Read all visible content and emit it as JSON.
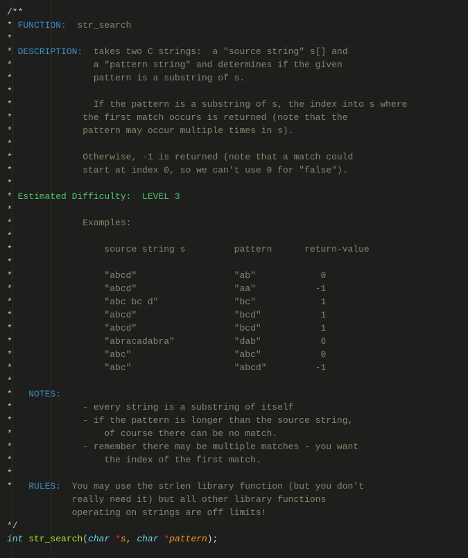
{
  "colors": {
    "background": "#1e1f1c",
    "comment_text": "#88846f",
    "star": "#cccccc",
    "header": "#3d8cc3",
    "difficulty": "#4fc36f",
    "keyword": "#66d9ef",
    "function": "#a6e22e",
    "operator": "#f92672",
    "identifier": "#fd971f",
    "punctuation": "#cccccc"
  },
  "lines": [
    [
      [
        "c-star",
        "/**"
      ]
    ],
    [
      [
        "c-star",
        "* "
      ],
      [
        "c-head",
        "FUNCTION:"
      ],
      [
        "c-comm",
        "  str_search"
      ]
    ],
    [
      [
        "c-star",
        "*"
      ]
    ],
    [
      [
        "c-star",
        "* "
      ],
      [
        "c-head",
        "DESCRIPTION:"
      ],
      [
        "c-comm",
        "  takes two C strings:  a \"source string\" s[] and"
      ]
    ],
    [
      [
        "c-star",
        "*"
      ],
      [
        "c-comm",
        "               a \"pattern string\" and determines if the given"
      ]
    ],
    [
      [
        "c-star",
        "*"
      ],
      [
        "c-comm",
        "               pattern is a substring of s."
      ]
    ],
    [
      [
        "c-star",
        "*"
      ]
    ],
    [
      [
        "c-star",
        "*"
      ],
      [
        "c-comm",
        "               If the pattern is a substring of s, the index into s where"
      ]
    ],
    [
      [
        "c-star",
        "*"
      ],
      [
        "c-comm",
        "             the first match occurs is returned (note that the"
      ]
    ],
    [
      [
        "c-star",
        "*"
      ],
      [
        "c-comm",
        "             pattern may occur multiple times in s)."
      ]
    ],
    [
      [
        "c-star",
        "*"
      ]
    ],
    [
      [
        "c-star",
        "*"
      ],
      [
        "c-comm",
        "             Otherwise, -1 is returned (note that a match could"
      ]
    ],
    [
      [
        "c-star",
        "*"
      ],
      [
        "c-comm",
        "             start at index 0, so we can't use 0 for \"false\")."
      ]
    ],
    [
      [
        "c-star",
        "*"
      ]
    ],
    [
      [
        "c-star",
        "* "
      ],
      [
        "c-diff",
        "Estimated Difficulty:  LEVEL 3"
      ]
    ],
    [
      [
        "c-star",
        "*"
      ]
    ],
    [
      [
        "c-star",
        "*"
      ],
      [
        "c-comm",
        "             Examples:"
      ]
    ],
    [
      [
        "c-star",
        "*"
      ]
    ],
    [
      [
        "c-star",
        "*"
      ],
      [
        "c-comm",
        "                 source string s         pattern      return-value"
      ]
    ],
    [
      [
        "c-star",
        "*"
      ]
    ],
    [
      [
        "c-star",
        "*"
      ],
      [
        "c-comm",
        "                 \"abcd\"                  \"ab\"            0"
      ]
    ],
    [
      [
        "c-star",
        "*"
      ],
      [
        "c-comm",
        "                 \"abcd\"                  \"aa\"           -1"
      ]
    ],
    [
      [
        "c-star",
        "*"
      ],
      [
        "c-comm",
        "                 \"abc bc d\"              \"bc\"            1"
      ]
    ],
    [
      [
        "c-star",
        "*"
      ],
      [
        "c-comm",
        "                 \"abcd\"                  \"bcd\"           1"
      ]
    ],
    [
      [
        "c-star",
        "*"
      ],
      [
        "c-comm",
        "                 \"abcd\"                  \"bcd\"           1"
      ]
    ],
    [
      [
        "c-star",
        "*"
      ],
      [
        "c-comm",
        "                 \"abracadabra\"           \"dab\"           6"
      ]
    ],
    [
      [
        "c-star",
        "*"
      ],
      [
        "c-comm",
        "                 \"abc\"                   \"abc\"           0"
      ]
    ],
    [
      [
        "c-star",
        "*"
      ],
      [
        "c-comm",
        "                 \"abc\"                   \"abcd\"         -1"
      ]
    ],
    [
      [
        "c-star",
        "*"
      ]
    ],
    [
      [
        "c-star",
        "*   "
      ],
      [
        "c-head",
        "NOTES:"
      ]
    ],
    [
      [
        "c-star",
        "*"
      ],
      [
        "c-comm",
        "             - every string is a substring of itself"
      ]
    ],
    [
      [
        "c-star",
        "*"
      ],
      [
        "c-comm",
        "             - if the pattern is longer than the source string,"
      ]
    ],
    [
      [
        "c-star",
        "*"
      ],
      [
        "c-comm",
        "                 of course there can be no match."
      ]
    ],
    [
      [
        "c-star",
        "*"
      ],
      [
        "c-comm",
        "             - remember there may be multiple matches - you want"
      ]
    ],
    [
      [
        "c-star",
        "*"
      ],
      [
        "c-comm",
        "                 the index of the first match."
      ]
    ],
    [
      [
        "c-star",
        "*"
      ]
    ],
    [
      [
        "c-star",
        "*   "
      ],
      [
        "c-head",
        "RULES:"
      ],
      [
        "c-comm",
        "  You may use the strlen library function (but you don't"
      ]
    ],
    [
      [
        "c-comm",
        "            really need it) but all other library functions"
      ]
    ],
    [
      [
        "c-comm",
        "            operating on strings are off limits!"
      ]
    ],
    [
      [
        "c-star",
        "*/"
      ]
    ],
    [
      [
        "c-kw",
        "int"
      ],
      [
        "c-pn",
        " "
      ],
      [
        "c-fn",
        "str_search"
      ],
      [
        "c-pn",
        "("
      ],
      [
        "c-kw",
        "char"
      ],
      [
        "c-pn",
        " "
      ],
      [
        "c-op",
        "*"
      ],
      [
        "c-id",
        "s"
      ],
      [
        "c-pn",
        ", "
      ],
      [
        "c-kw",
        "char"
      ],
      [
        "c-pn",
        " "
      ],
      [
        "c-op",
        "*"
      ],
      [
        "c-id",
        "pattern"
      ],
      [
        "c-pn",
        ");"
      ]
    ]
  ]
}
